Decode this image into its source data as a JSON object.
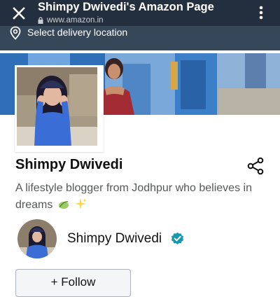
{
  "browser": {
    "title": "Shimpy Dwivedi's Amazon Page",
    "url": "www.amazon.in",
    "close_icon": "close-icon",
    "menu_icon": "more-vert-icon"
  },
  "delivery": {
    "label": "Select delivery location",
    "icon": "location-pin-icon"
  },
  "profile": {
    "name": "Shimpy Dwivedi",
    "bio": "A lifestyle blogger from Jodhpur who believes in dreams",
    "bio_emojis": [
      "leaf-emoji-icon",
      "sparkles-emoji-icon"
    ],
    "share_icon": "share-icon"
  },
  "follow_row": {
    "name": "Shimpy Dwivedi",
    "verified_icon": "verified-check-icon",
    "button_label": "+ Follow"
  },
  "colors": {
    "header_bg": "#232f3e",
    "delivery_bg": "#37475a",
    "verified": "#1a98b0"
  }
}
